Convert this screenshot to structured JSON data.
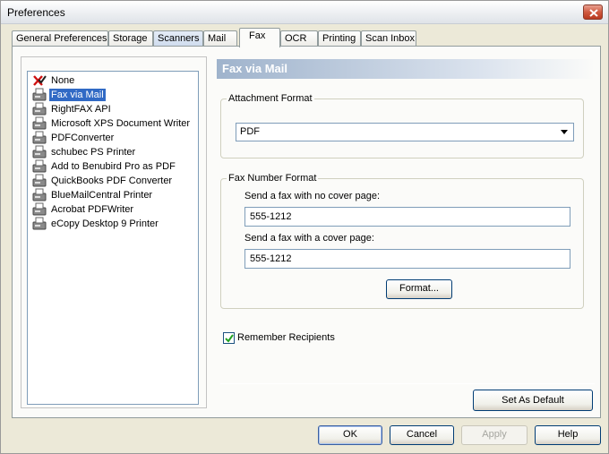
{
  "window": {
    "title": "Preferences"
  },
  "tabs": [
    {
      "label": "General Preferences",
      "state": "normal"
    },
    {
      "label": "Storage",
      "state": "normal"
    },
    {
      "label": "Scanners",
      "state": "highlighted"
    },
    {
      "label": "Mail",
      "state": "normal"
    },
    {
      "label": "Fax",
      "state": "active"
    },
    {
      "label": "OCR",
      "state": "normal"
    },
    {
      "label": "Printing",
      "state": "normal"
    },
    {
      "label": "Scan Inbox",
      "state": "normal"
    }
  ],
  "fax_list": {
    "items": [
      {
        "label": "None",
        "icon": "red-x-check-icon",
        "selected": false
      },
      {
        "label": "Fax via Mail",
        "icon": "fax-machine-icon",
        "selected": true
      },
      {
        "label": "RightFAX API",
        "icon": "fax-machine-icon",
        "selected": false
      },
      {
        "label": "Microsoft XPS Document Writer",
        "icon": "fax-machine-icon",
        "selected": false
      },
      {
        "label": "PDFConverter",
        "icon": "fax-machine-icon",
        "selected": false
      },
      {
        "label": "schubec PS Printer",
        "icon": "fax-machine-icon",
        "selected": false
      },
      {
        "label": "Add to Benubird Pro as PDF",
        "icon": "fax-machine-icon",
        "selected": false
      },
      {
        "label": "QuickBooks PDF Converter",
        "icon": "fax-machine-icon",
        "selected": false
      },
      {
        "label": "BlueMailCentral Printer",
        "icon": "fax-machine-icon",
        "selected": false
      },
      {
        "label": "Acrobat PDFWriter",
        "icon": "fax-machine-icon",
        "selected": false
      },
      {
        "label": "eCopy Desktop 9 Printer",
        "icon": "fax-machine-icon",
        "selected": false
      }
    ]
  },
  "detail": {
    "header": "Fax via Mail",
    "attachment_format": {
      "legend": "Attachment Format",
      "selected_value": "PDF"
    },
    "fax_number_format": {
      "legend": "Fax Number Format",
      "no_cover_label": "Send a fax with no cover page:",
      "no_cover_value": "555-1212",
      "cover_label": "Send a fax with a cover page:",
      "cover_value": "555-1212",
      "format_button": "Format..."
    },
    "remember_recipients": {
      "label": "Remember Recipients",
      "checked": true
    },
    "set_default_button": "Set As Default"
  },
  "footer": {
    "ok": "OK",
    "cancel": "Cancel",
    "apply": "Apply",
    "help": "Help"
  },
  "colors": {
    "selection": "#316ac5",
    "header_gradient_start": "#9fb3cc",
    "window_bg": "#ece9d8"
  }
}
